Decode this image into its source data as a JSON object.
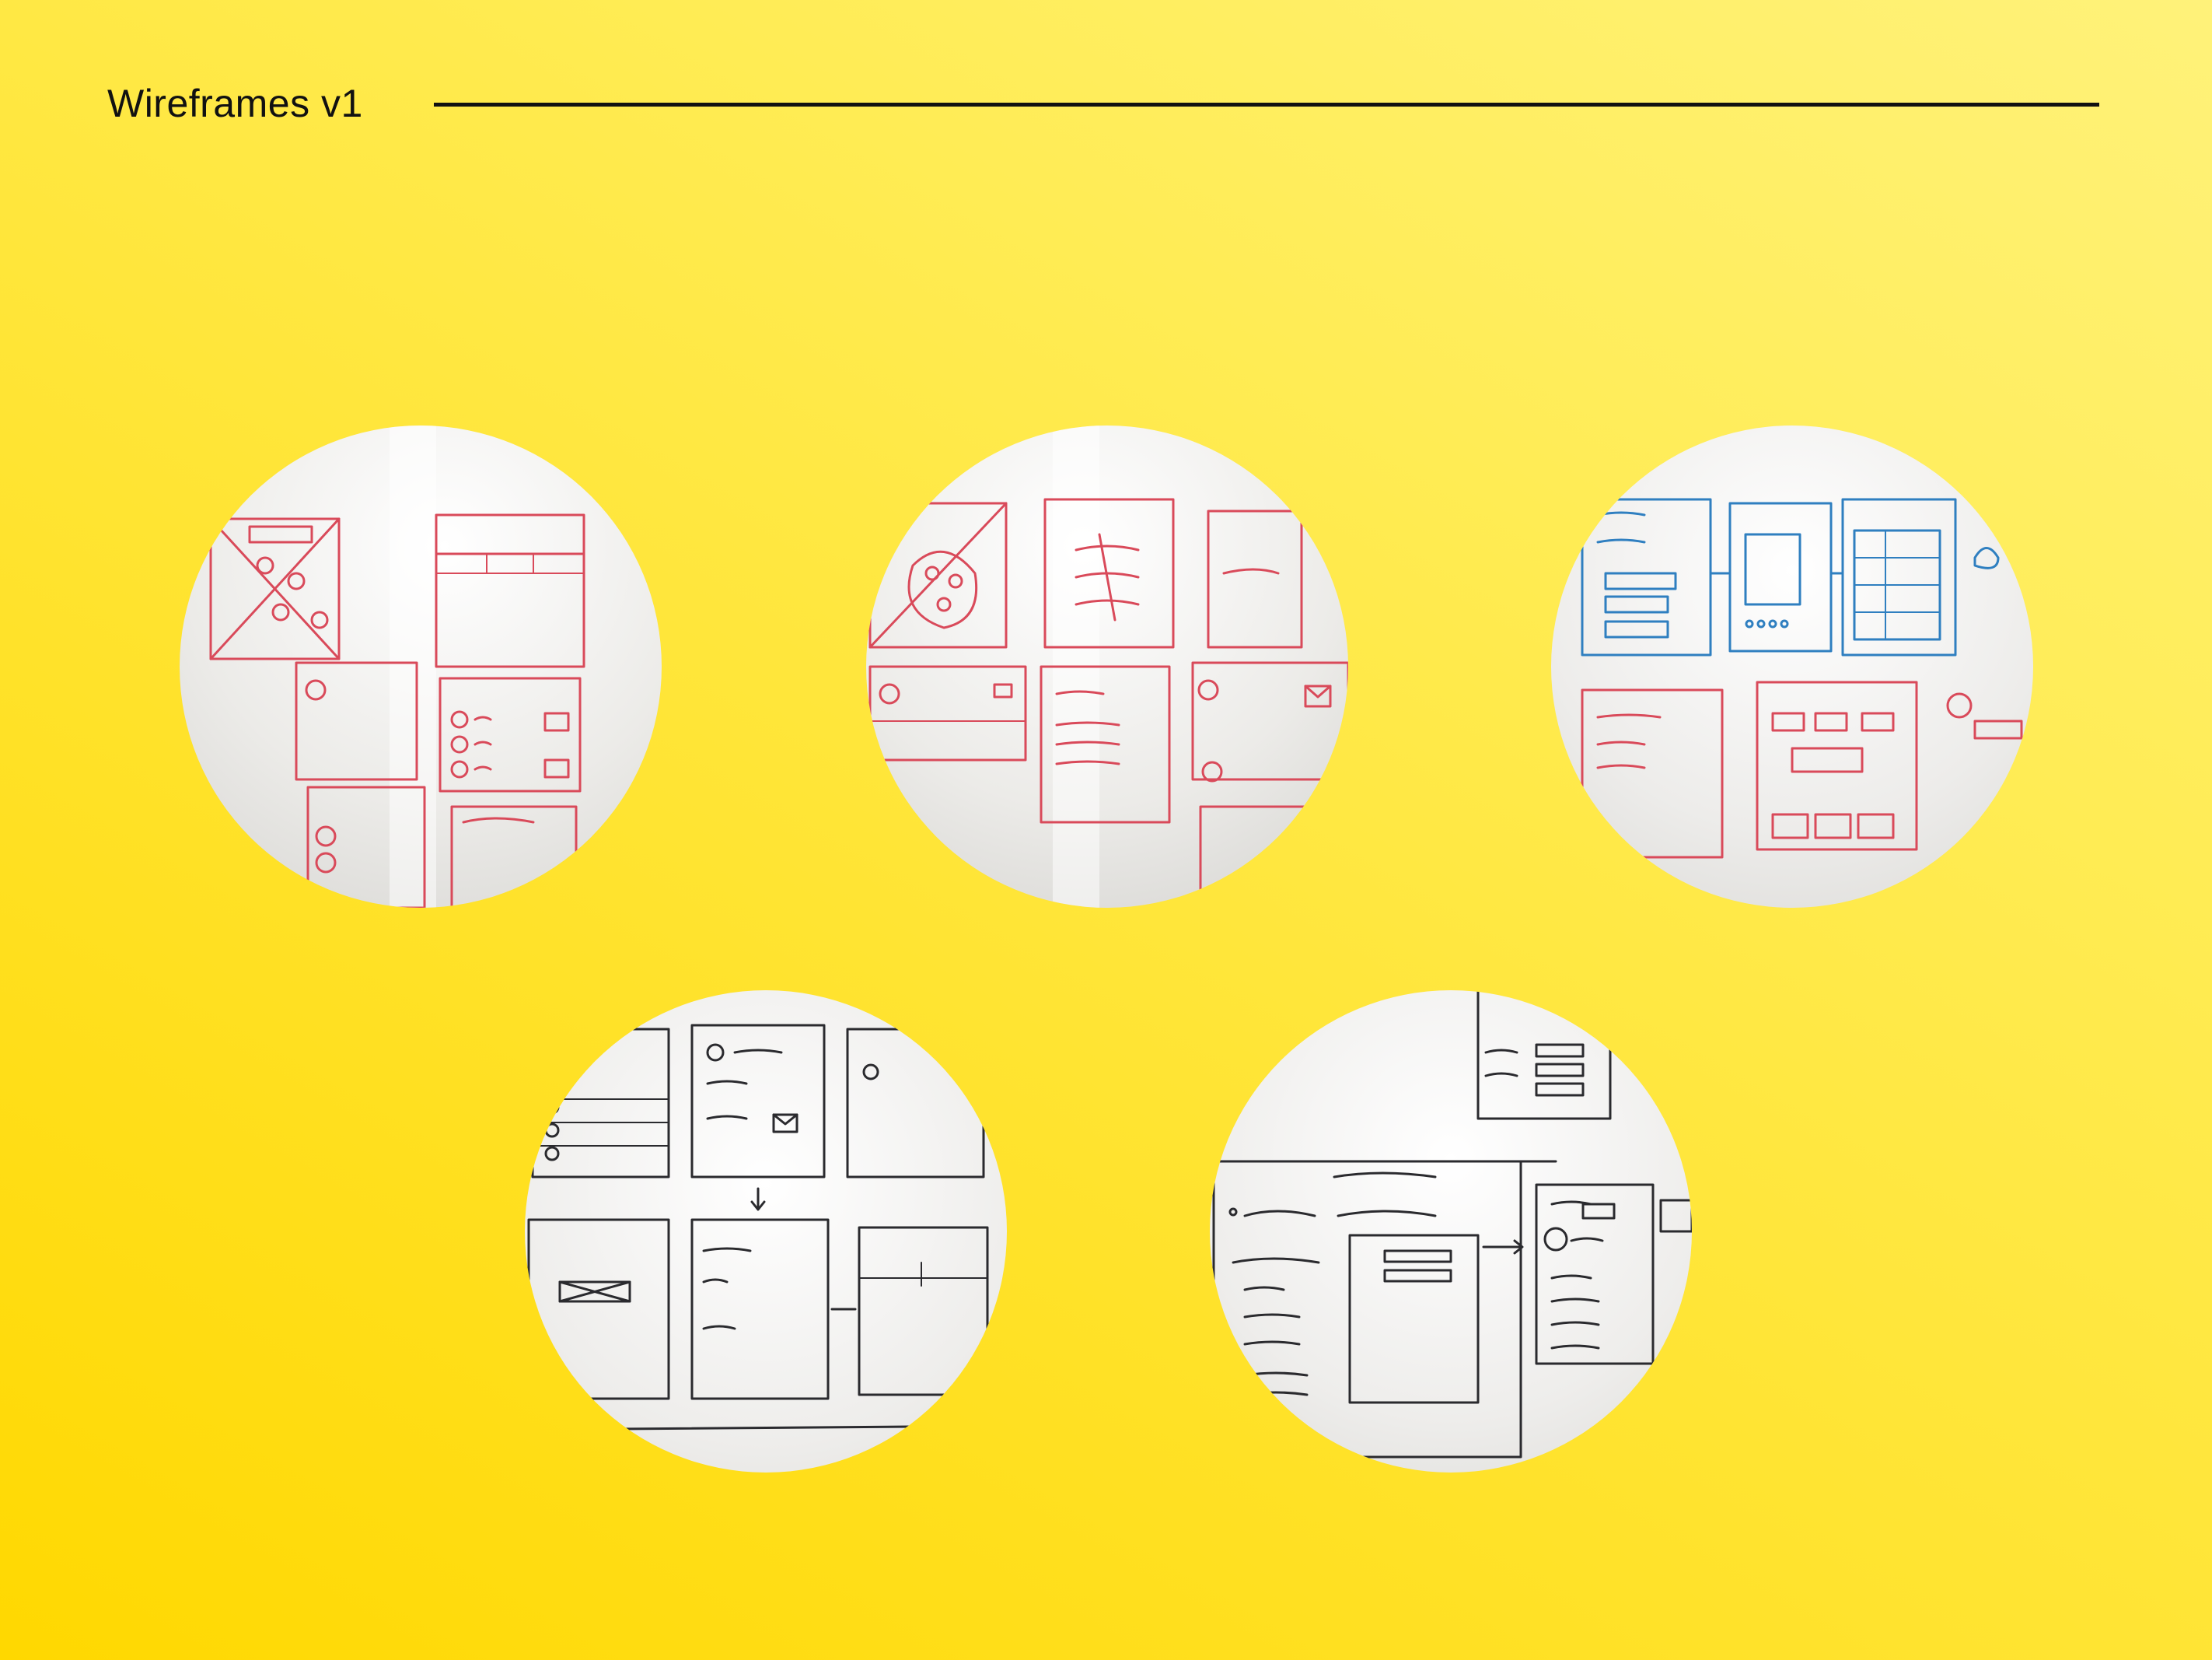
{
  "header": {
    "title": "Wireframes v1"
  },
  "photos": [
    {
      "subject": "whiteboard-wireframe-sketch",
      "ink": "red",
      "ink_color": "#d94a5a"
    },
    {
      "subject": "whiteboard-wireframe-sketch",
      "ink": "red",
      "ink_color": "#d94a5a"
    },
    {
      "subject": "whiteboard-wireframe-sketch",
      "ink": "blue-and-red",
      "ink_color": "#2f7fc0"
    },
    {
      "subject": "whiteboard-wireframe-sketch",
      "ink": "black",
      "ink_color": "#2a2a2e"
    },
    {
      "subject": "whiteboard-wireframe-sketch",
      "ink": "black",
      "ink_color": "#2a2a2e"
    }
  ],
  "colors": {
    "background": "#ffe22a",
    "title_text": "#111111",
    "whiteboard": "#f2f1ee"
  }
}
